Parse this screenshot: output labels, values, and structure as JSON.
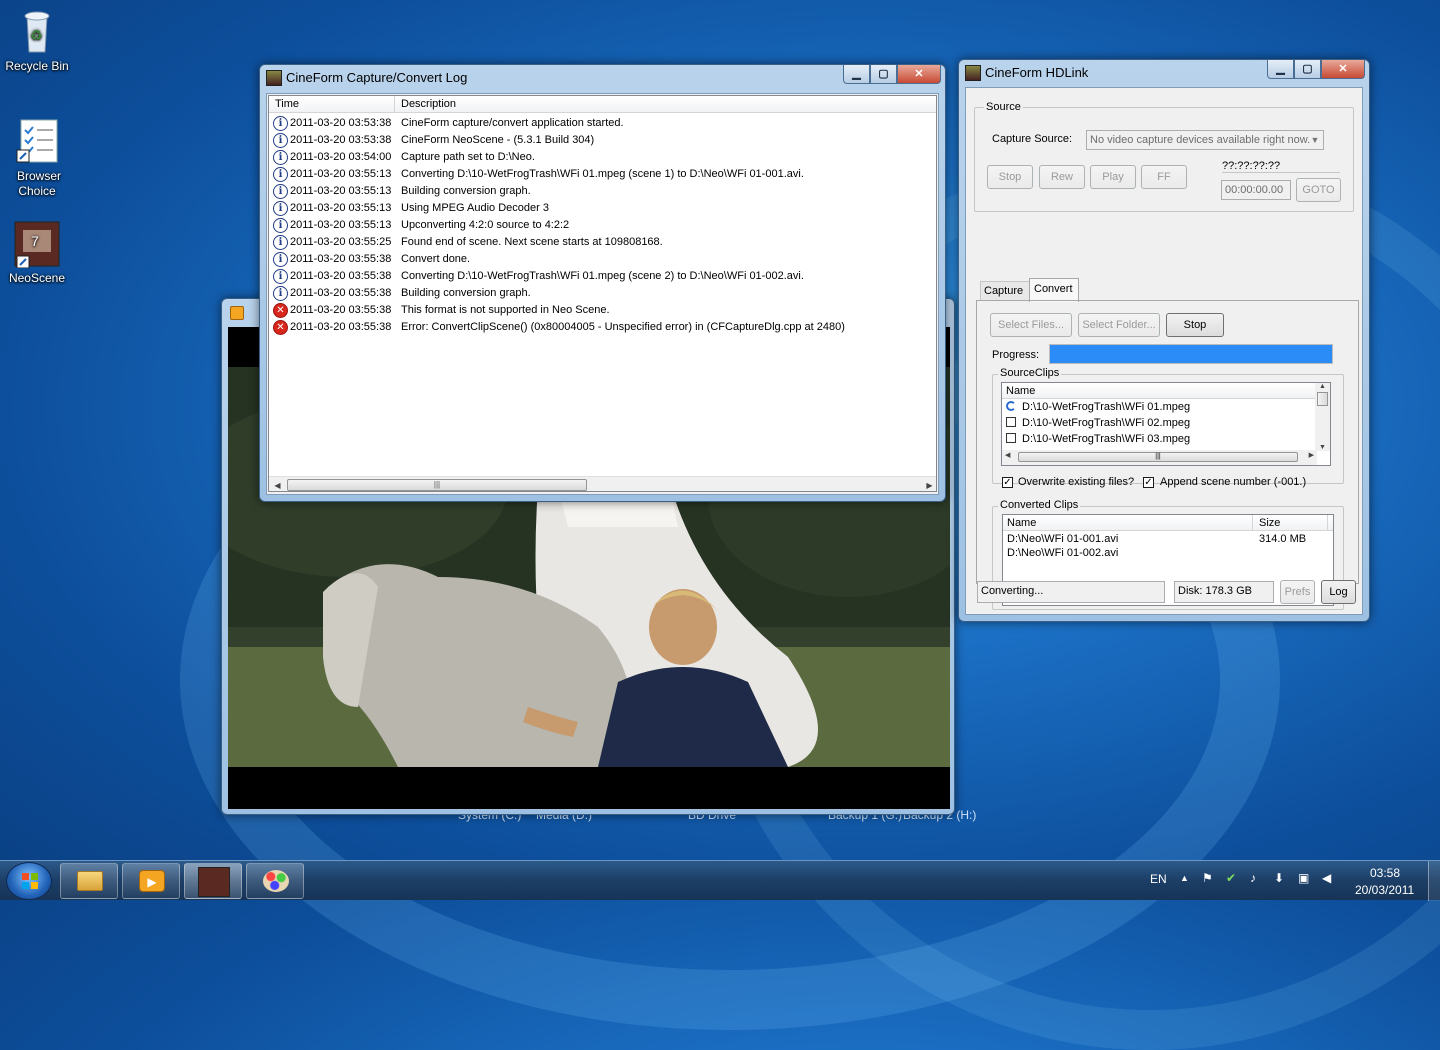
{
  "desktop": {
    "icons": [
      {
        "label": "Recycle Bin"
      },
      {
        "label": "Browser Choice"
      },
      {
        "label": "NeoScene"
      }
    ],
    "behind_labels": [
      "System (C:)",
      "Media (D:)",
      "BD Drive",
      "Backup 1 (G:)",
      "Backup 2 (H:)"
    ]
  },
  "log_window": {
    "title": "CineForm Capture/Convert Log",
    "columns": [
      "Time",
      "Description"
    ],
    "rows": [
      {
        "type": "info",
        "time": "2011-03-20 03:53:38",
        "desc": "CineForm capture/convert application started."
      },
      {
        "type": "info",
        "time": "2011-03-20 03:53:38",
        "desc": "CineForm NeoScene - (5.3.1 Build 304)"
      },
      {
        "type": "info",
        "time": "2011-03-20 03:54:00",
        "desc": "Capture path set to D:\\Neo."
      },
      {
        "type": "info",
        "time": "2011-03-20 03:55:13",
        "desc": "Converting D:\\10-WetFrogTrash\\WFi 01.mpeg (scene 1) to D:\\Neo\\WFi 01-001.avi."
      },
      {
        "type": "info",
        "time": "2011-03-20 03:55:13",
        "desc": "Building conversion graph."
      },
      {
        "type": "info",
        "time": "2011-03-20 03:55:13",
        "desc": "Using MPEG Audio Decoder 3"
      },
      {
        "type": "info",
        "time": "2011-03-20 03:55:13",
        "desc": "Upconverting 4:2:0 source to 4:2:2"
      },
      {
        "type": "info",
        "time": "2011-03-20 03:55:25",
        "desc": "Found end of scene.  Next scene starts at 109808168."
      },
      {
        "type": "info",
        "time": "2011-03-20 03:55:38",
        "desc": "Convert done."
      },
      {
        "type": "info",
        "time": "2011-03-20 03:55:38",
        "desc": "Converting D:\\10-WetFrogTrash\\WFi 01.mpeg (scene 2) to D:\\Neo\\WFi 01-002.avi."
      },
      {
        "type": "info",
        "time": "2011-03-20 03:55:38",
        "desc": "Building conversion graph."
      },
      {
        "type": "error",
        "time": "2011-03-20 03:55:38",
        "desc": "This format is not supported in Neo Scene."
      },
      {
        "type": "error",
        "time": "2011-03-20 03:55:38",
        "desc": "Error: ConvertClipScene() (0x80004005 - Unspecified error) in (CFCaptureDlg.cpp at 2480)"
      }
    ]
  },
  "hdlink": {
    "title": "CineForm HDLink",
    "source": {
      "group_label": "Source",
      "capture_label": "Capture Source:",
      "capture_value": "No video capture devices available right now.",
      "timecode": "??:??:??:??",
      "goto_value": "00:00:00.00",
      "buttons": {
        "stop": "Stop",
        "rew": "Rew",
        "play": "Play",
        "ff": "FF",
        "goto": "GOTO"
      }
    },
    "tabs": [
      "Capture",
      "Convert"
    ],
    "active_tab": "Convert",
    "convert": {
      "select_files": "Select Files...",
      "select_folder": "Select Folder...",
      "stop": "Stop",
      "progress_label": "Progress:",
      "progress": 1.0,
      "source_clips_label": "SourceClips",
      "source_col": "Name",
      "source_clips": [
        "D:\\10-WetFrogTrash\\WFi 01.mpeg",
        "D:\\10-WetFrogTrash\\WFi 02.mpeg",
        "D:\\10-WetFrogTrash\\WFi 03.mpeg"
      ],
      "overwrite_label": "Overwrite existing files?",
      "overwrite_checked": true,
      "append_label": "Append scene number (-001.)",
      "append_checked": true,
      "converted_label": "Converted Clips",
      "converted_cols": [
        "Name",
        "Size"
      ],
      "converted": [
        {
          "name": "D:\\Neo\\WFi 01-001.avi",
          "size": "314.0 MB"
        },
        {
          "name": "D:\\Neo\\WFi 01-002.avi",
          "size": ""
        }
      ]
    },
    "status": {
      "text": "Converting...",
      "disk": "Disk: 178.3 GB",
      "prefs": "Prefs",
      "log": "Log"
    }
  },
  "taskbar": {
    "language": "EN",
    "time": "03:58",
    "date": "20/03/2011"
  },
  "colors": {
    "progress": "#2b8cf7",
    "accent": "#1b6fc4"
  }
}
